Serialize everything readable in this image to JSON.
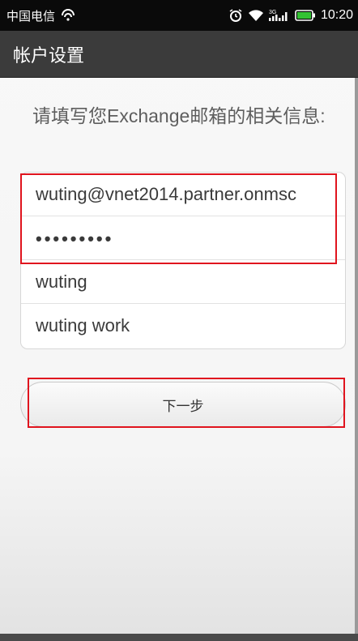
{
  "status_bar": {
    "carrier": "中国电信",
    "time": "10:20",
    "network_label": "3G"
  },
  "title_bar": {
    "title": "帐户设置"
  },
  "instruction": {
    "text": "请填写您Exchange邮箱的相关信息:"
  },
  "form": {
    "email_value": "wuting@vnet2014.partner.onmsc",
    "password_value": "•••••••••",
    "username_value": "wuting",
    "account_name_value": "wuting work"
  },
  "next_button": {
    "label": "下一步"
  },
  "colors": {
    "highlight": "#e0141e",
    "title_bar": "#3b3b3b",
    "battery": "#33c233"
  }
}
